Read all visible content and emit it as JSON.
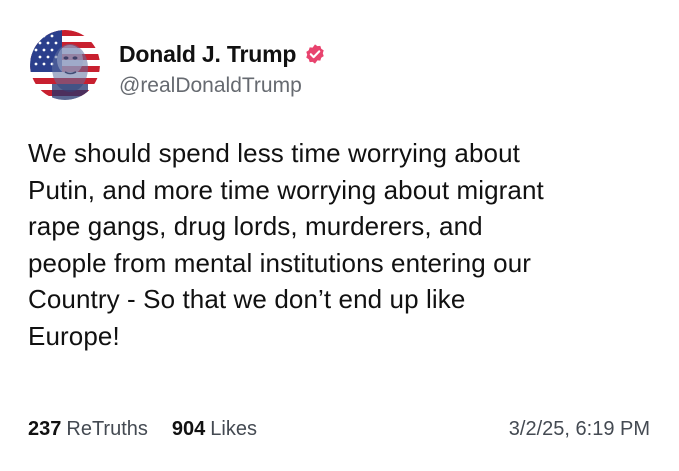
{
  "post": {
    "author": {
      "display_name": "Donald J. Trump",
      "handle": "@realDonaldTrump",
      "verified": true,
      "verified_badge_icon": "verified-badge-icon",
      "verified_badge_color": "#e8436e",
      "avatar_icon": "profile-avatar"
    },
    "text": "We should spend less time worrying about\nPutin, and more time worrying about migrant\nrape gangs, drug lords, murderers, and\npeople from mental institutions entering our\nCountry - So that we don’t end up like\nEurope!",
    "stats": {
      "retruths_count": "237",
      "retruths_label": "ReTruths",
      "likes_count": "904",
      "likes_label": "Likes"
    },
    "timestamp": "3/2/25, 6:19 PM"
  }
}
